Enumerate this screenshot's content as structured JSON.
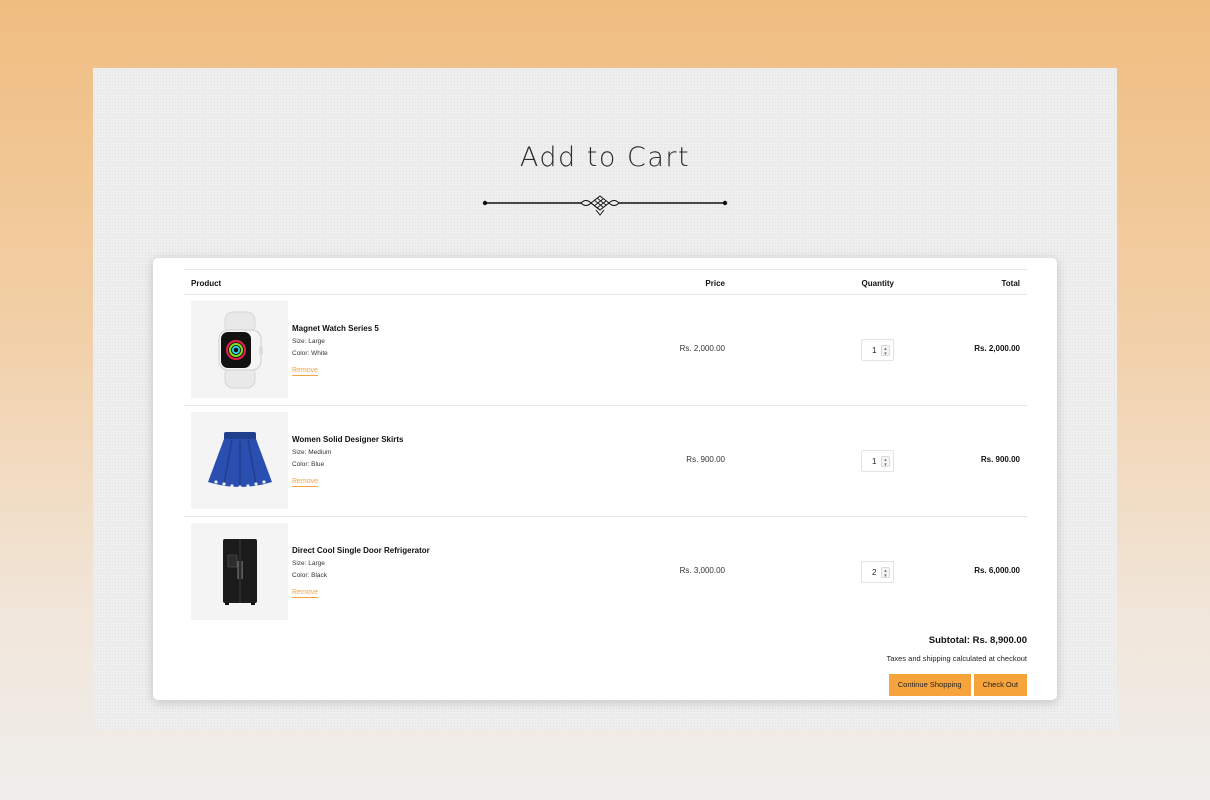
{
  "page": {
    "title": "Add to Cart"
  },
  "table": {
    "headers": {
      "product": "Product",
      "price": "Price",
      "quantity": "Quantity",
      "total": "Total"
    }
  },
  "items": [
    {
      "name": "Magnet Watch Series 5",
      "size": "Size: Large",
      "color": "Color: White",
      "remove": "Remove",
      "price": "Rs. 2,000.00",
      "qty": "1",
      "total": "Rs. 2,000.00",
      "icon": "smartwatch-image"
    },
    {
      "name": "Women Solid Designer Skirts",
      "size": "Size: Medium",
      "color": "Color: Blue",
      "remove": "Remove",
      "price": "Rs. 900.00",
      "qty": "1",
      "total": "Rs. 900.00",
      "icon": "skirt-image"
    },
    {
      "name": "Direct Cool Single Door Refrigerator",
      "size": "Size: Large",
      "color": "Color: Black",
      "remove": "Remove",
      "price": "Rs. 3,000.00",
      "qty": "2",
      "total": "Rs. 6,000.00",
      "icon": "refrigerator-image"
    }
  ],
  "summary": {
    "subtotal": "Subtotal: Rs. 8,900.00",
    "taxes_note": "Taxes and shipping calculated at checkout",
    "continue_label": "Continue Shopping",
    "checkout_label": "Check Out"
  },
  "colors": {
    "accent": "#f7a33b",
    "remove_link": "#f3a33f",
    "background_top": "#f0bd80",
    "panel": "#eeeeee"
  }
}
